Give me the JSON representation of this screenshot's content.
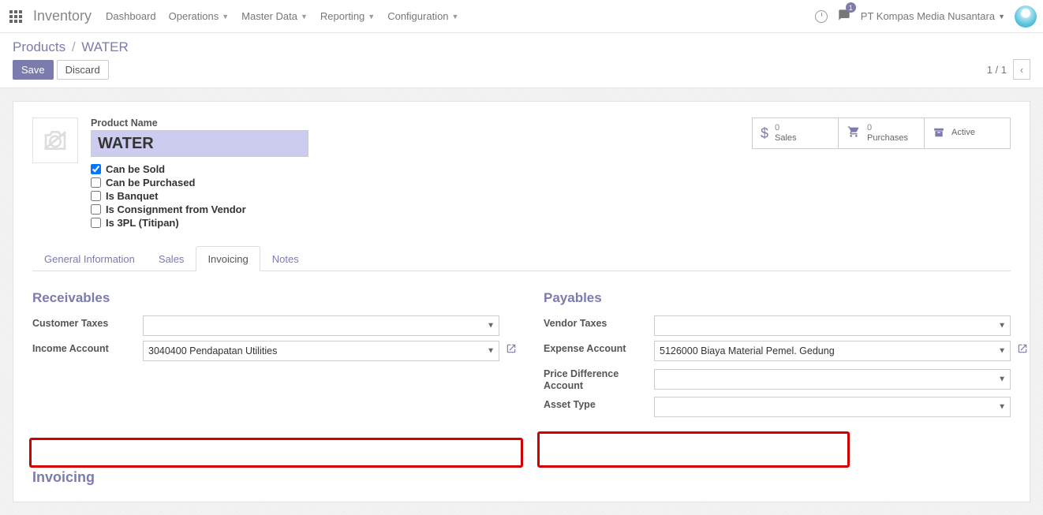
{
  "topbar": {
    "app": "Inventory",
    "menu": [
      "Dashboard",
      "Operations",
      "Master Data",
      "Reporting",
      "Configuration"
    ],
    "menu_dropdown": [
      false,
      true,
      true,
      true,
      true
    ],
    "msg_count": "1",
    "company": "PT Kompas Media Nusantara"
  },
  "breadcrumb": {
    "root": "Products",
    "current": "WATER"
  },
  "buttons": {
    "save": "Save",
    "discard": "Discard"
  },
  "pager": {
    "pos": "1 / 1"
  },
  "form": {
    "name_label": "Product Name",
    "name_value": "WATER",
    "checks": {
      "sold": "Can be Sold",
      "purchased": "Can be Purchased",
      "banquet": "Is Banquet",
      "consign": "Is Consignment from Vendor",
      "tpl": "Is 3PL (Titipan)"
    },
    "sold_checked": true
  },
  "stats": {
    "sales_n": "0",
    "sales_l": "Sales",
    "purch_n": "0",
    "purch_l": "Purchases",
    "active_l": "Active"
  },
  "tabs": [
    "General Information",
    "Sales",
    "Invoicing",
    "Notes"
  ],
  "active_tab": 2,
  "receivables": {
    "title": "Receivables",
    "cust_tax": "Customer Taxes",
    "income_acc": "Income Account",
    "income_val": "3040400 Pendapatan Utilities"
  },
  "payables": {
    "title": "Payables",
    "vendor_tax": "Vendor Taxes",
    "expense_acc": "Expense Account",
    "expense_val": "5126000 Biaya Material Pemel. Gedung",
    "price_diff": "Price Difference Account",
    "asset_type": "Asset Type"
  },
  "invoicing_title": "Invoicing"
}
